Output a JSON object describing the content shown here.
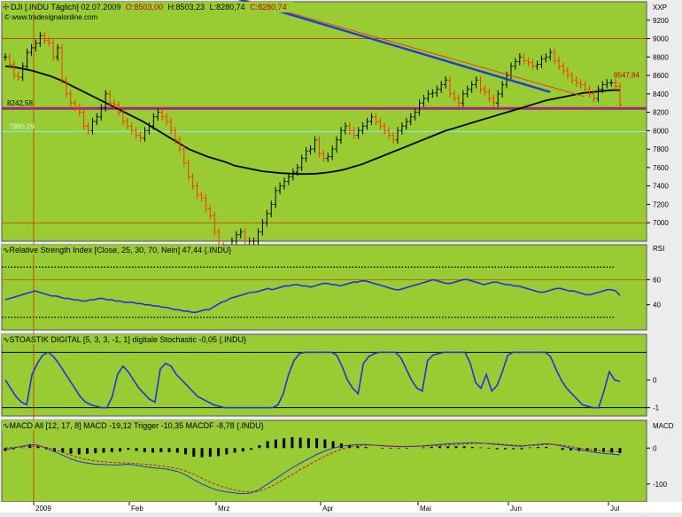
{
  "colors": {
    "plot_bg": "#99cc33",
    "frame_bg": "#ffffff",
    "axis_bg": "#ffffff",
    "candle_up": "#000000",
    "candle_down": "#ff3300",
    "trend_blue": "#1f3fd0",
    "trend_red": "#e8401c",
    "ma_line": "#000000",
    "support_line": "#9b2a7a",
    "level_line": "#7ef2ff",
    "grid_red": "#cc3300",
    "indicator_blue": "#1d33dd",
    "signal_red": "#cc1111",
    "dotted": "#000000"
  },
  "header": {
    "title": "DJI [.INDU Täglich] 02.07.2009",
    "ohlc": {
      "o_label": "O:",
      "o": "8503,00",
      "h_label": "H:",
      "h": "8503,23",
      "l_label": "L:",
      "l": "8280,74",
      "c_label": "C:",
      "c": "8280,74"
    },
    "watermark": "© www.tradesignalonline.com",
    "axis_unit": "XXP"
  },
  "chart_data": [
    {
      "type": "candlestick",
      "panel": "price",
      "title": "DJI [.INDU Täglich] 02.07.2009",
      "ylim": [
        6800,
        9400
      ],
      "yticks": [
        7000,
        7200,
        7400,
        7600,
        7800,
        8000,
        8200,
        8400,
        8600,
        8800,
        9000,
        9200,
        9400
      ],
      "ytick_labels": [
        "7000",
        "7200",
        "7400",
        "7600",
        "7800",
        "8000",
        "8200",
        "8400",
        "8600",
        "8800",
        "9000",
        "9200",
        "XXP"
      ],
      "x_labels": [
        "2009",
        "Feb",
        "Mrz",
        "Apr",
        "Mai",
        "Jun",
        "Jul"
      ],
      "annotations": [
        {
          "text": "8547,84",
          "value": 8547.84
        },
        {
          "text": "8242,58",
          "value": 8242.58
        },
        {
          "text": "7990,29",
          "value": 7990.29
        }
      ],
      "horizontal_lines": [
        {
          "name": "support",
          "value": 8242.58
        },
        {
          "name": "level",
          "value": 7990.29
        },
        {
          "name": "grid-9000",
          "value": 9000
        },
        {
          "name": "grid-7000",
          "value": 7000
        }
      ],
      "trendlines": [
        {
          "name": "blue-trend",
          "points": [
            [
              52,
              9450
            ],
            [
              125,
              8420
            ]
          ]
        },
        {
          "name": "red-trend",
          "points": [
            [
              55,
              9420
            ],
            [
              127,
              8450
            ]
          ]
        }
      ],
      "closes": [
        8800,
        8720,
        8600,
        8580,
        8700,
        8850,
        8900,
        8950,
        9034,
        8980,
        8952,
        8800,
        8900,
        8550,
        8400,
        8300,
        8250,
        8200,
        8050,
        8000,
        8100,
        8150,
        8250,
        8400,
        8300,
        8280,
        8200,
        8100,
        8050,
        8000,
        7950,
        7920,
        8000,
        8050,
        8150,
        8200,
        8150,
        8100,
        8000,
        7900,
        7800,
        7650,
        7500,
        7400,
        7300,
        7270,
        7150,
        7080,
        6900,
        6750,
        6550,
        6700,
        6800,
        6870,
        6900,
        6720,
        6800,
        6800,
        6900,
        7000,
        7100,
        7200,
        7350,
        7400,
        7450,
        7500,
        7550,
        7600,
        7700,
        7780,
        7800,
        7900,
        7750,
        7700,
        7720,
        7800,
        7900,
        8000,
        8050,
        8000,
        7950,
        8000,
        8050,
        8100,
        8150,
        8100,
        8050,
        8000,
        7950,
        7900,
        8000,
        8050,
        8100,
        8150,
        8200,
        8300,
        8350,
        8400,
        8410,
        8450,
        8500,
        8550,
        8400,
        8350,
        8300,
        8400,
        8450,
        8500,
        8550,
        8450,
        8420,
        8350,
        8300,
        8400,
        8500,
        8600,
        8700,
        8750,
        8800,
        8760,
        8740,
        8700,
        8720,
        8780,
        8800,
        8850,
        8760,
        8700,
        8650,
        8600,
        8550,
        8520,
        8500,
        8450,
        8400,
        8350,
        8450,
        8500,
        8520,
        8520,
        8480,
        8280
      ],
      "series": [
        {
          "name": "MA",
          "values": [
            8700,
            8690,
            8670,
            8650,
            8620,
            8590,
            8550,
            8500,
            8450,
            8400,
            8350,
            8300,
            8250,
            8200,
            8150,
            8100,
            8040,
            7980,
            7920,
            7860,
            7800,
            7760,
            7720,
            7690,
            7660,
            7620,
            7600,
            7580,
            7560,
            7550,
            7540,
            7535,
            7530,
            7530,
            7535,
            7545,
            7560,
            7580,
            7610,
            7640,
            7680,
            7720,
            7760,
            7800,
            7840,
            7880,
            7920,
            7960,
            8000,
            8030,
            8060,
            8090,
            8120,
            8150,
            8180,
            8210,
            8240,
            8270,
            8300,
            8330,
            8350,
            8370,
            8390,
            8410,
            8420,
            8430,
            8440,
            8440
          ]
        }
      ]
    },
    {
      "type": "line",
      "panel": "rsi",
      "title": "Relative Strength Index [Close, 25, 30, 70, Nein] 47,44 {.INDU}",
      "ylim": [
        20,
        80
      ],
      "yticks": [
        40,
        60
      ],
      "ytick_labels": [
        "40",
        "60"
      ],
      "axis_unit": "RSI",
      "thresholds": [
        30,
        70
      ],
      "series": [
        {
          "name": "RSI",
          "values": [
            44,
            45,
            46,
            47,
            48,
            49,
            50,
            51,
            50,
            49,
            48,
            47,
            47,
            46,
            45,
            45,
            44,
            44,
            43,
            43,
            44,
            44,
            45,
            45,
            44,
            44,
            43,
            43,
            42,
            42,
            42,
            41,
            41,
            40,
            40,
            39,
            39,
            38,
            38,
            37,
            36,
            36,
            35,
            35,
            34,
            34,
            35,
            36,
            36,
            38,
            40,
            42,
            43,
            45,
            46,
            47,
            48,
            49,
            50,
            50,
            51,
            52,
            53,
            52,
            53,
            54,
            55,
            55,
            56,
            56,
            55,
            55,
            54,
            55,
            56,
            57,
            57,
            56,
            56,
            55,
            56,
            57,
            58,
            58,
            59,
            59,
            58,
            57,
            56,
            55,
            54,
            53,
            52,
            52,
            53,
            54,
            55,
            56,
            57,
            58,
            59,
            60,
            59,
            58,
            57,
            57,
            58,
            59,
            60,
            60,
            59,
            58,
            57,
            56,
            57,
            58,
            58,
            57,
            56,
            56,
            55,
            55,
            54,
            53,
            52,
            51,
            50,
            50,
            51,
            52,
            53,
            53,
            52,
            51,
            51,
            50,
            49,
            48,
            48,
            49,
            50,
            51,
            52,
            52,
            51,
            47.44
          ]
        }
      ]
    },
    {
      "type": "line",
      "panel": "stochastic",
      "title": "STOASTIK DIGITAL [5, 3, 3, -1, 1] digitale Stochastic -0,05 {.INDU}",
      "ylim": [
        -1.3,
        1.3
      ],
      "yticks": [
        0,
        -1
      ],
      "ytick_labels": [
        "0",
        "-1"
      ],
      "series": [
        {
          "name": "digitale Stochastic",
          "values": [
            0,
            -0.3,
            -0.6,
            -0.8,
            -0.9,
            0.2,
            0.6,
            0.9,
            1,
            0.85,
            0.6,
            0.3,
            0.0,
            -0.3,
            -0.6,
            -0.8,
            -0.9,
            -0.95,
            -1,
            -1,
            -0.6,
            0.2,
            0.5,
            0.3,
            0.0,
            -0.3,
            -0.5,
            -0.7,
            -0.8,
            0.4,
            0.6,
            0.5,
            0.2,
            0.0,
            -0.2,
            -0.4,
            -0.6,
            -0.7,
            -0.8,
            -0.9,
            -0.95,
            -1,
            -1,
            -1,
            -1,
            -1,
            -1,
            -1,
            -1,
            -1,
            -1,
            -0.9,
            -0.5,
            0.2,
            0.7,
            0.95,
            1,
            1,
            1,
            1,
            1,
            1,
            0.9,
            0.5,
            0.0,
            -0.3,
            -0.5,
            0.6,
            0.85,
            0.95,
            1,
            1,
            1,
            1,
            0.8,
            0.4,
            0.0,
            -0.3,
            -0.4,
            0.7,
            0.9,
            0.95,
            1,
            1,
            1,
            1,
            1,
            0.6,
            -0.1,
            -0.3,
            0.2,
            -0.4,
            -0.2,
            0.3,
            0.9,
            1,
            1,
            1,
            1,
            1,
            1,
            1,
            0.85,
            0.4,
            0.0,
            -0.3,
            -0.5,
            -0.7,
            -0.9,
            -0.95,
            -1,
            -1,
            -0.4,
            0.3,
            0.0,
            -0.05
          ]
        }
      ]
    },
    {
      "type": "bar",
      "panel": "macd",
      "title": "MACD All [12, 17, 8] MACD -19,12 Trigger -10,35 MACDF -8,78 {.INDU}",
      "ylim": [
        -150,
        50
      ],
      "yticks": [
        0,
        -100
      ],
      "ytick_labels": [
        "0",
        "-100"
      ],
      "axis_unit": "MACD",
      "series": [
        {
          "name": "MACD",
          "values": [
            -5,
            0,
            5,
            10,
            8,
            0,
            -10,
            -20,
            -30,
            -38,
            -42,
            -45,
            -46,
            -47,
            -47,
            -45,
            -48,
            -52,
            -55,
            -57,
            -60,
            -65,
            -75,
            -88,
            -100,
            -110,
            -118,
            -122,
            -125,
            -127,
            -125,
            -115,
            -100,
            -85,
            -70,
            -55,
            -42,
            -30,
            -18,
            -8,
            0,
            5,
            8,
            10,
            10,
            8,
            6,
            5,
            4,
            4,
            5,
            6,
            8,
            10,
            12,
            13,
            14,
            15,
            14,
            12,
            10,
            8,
            6,
            5,
            8,
            10,
            12,
            10,
            5,
            0,
            -5,
            -8,
            -12,
            -15,
            -17,
            -19.12
          ]
        },
        {
          "name": "Trigger",
          "values": [
            0,
            2,
            4,
            5,
            5,
            2,
            -4,
            -12,
            -20,
            -27,
            -32,
            -36,
            -38,
            -40,
            -41,
            -42,
            -43,
            -45,
            -47,
            -50,
            -53,
            -57,
            -64,
            -73,
            -84,
            -95,
            -104,
            -111,
            -117,
            -121,
            -122,
            -120,
            -112,
            -100,
            -87,
            -74,
            -60,
            -47,
            -35,
            -23,
            -12,
            -3,
            3,
            7,
            8,
            8,
            7,
            6,
            5,
            5,
            5,
            5,
            6,
            7,
            9,
            10,
            11,
            13,
            13,
            13,
            12,
            10,
            8,
            7,
            7,
            8,
            10,
            10,
            8,
            4,
            0,
            -3,
            -6,
            -8,
            -9,
            -10.35
          ]
        },
        {
          "name": "MACDF",
          "values": [
            -5,
            -2,
            1,
            5,
            3,
            -2,
            -6,
            -8,
            -10,
            -11,
            -10,
            -9,
            -8,
            -7,
            -6,
            -3,
            -5,
            -7,
            -8,
            -7,
            -7,
            -8,
            -11,
            -15,
            -16,
            -15,
            -14,
            -11,
            -8,
            -6,
            -3,
            5,
            12,
            15,
            17,
            19,
            18,
            17,
            17,
            15,
            12,
            8,
            5,
            3,
            2,
            0,
            -1,
            -1,
            -1,
            -1,
            0,
            1,
            2,
            3,
            3,
            3,
            3,
            2,
            1,
            -1,
            -2,
            -2,
            -2,
            -2,
            1,
            2,
            2,
            0,
            -3,
            -4,
            -5,
            -5,
            -6,
            -7,
            -8,
            -8.78
          ]
        }
      ]
    }
  ]
}
